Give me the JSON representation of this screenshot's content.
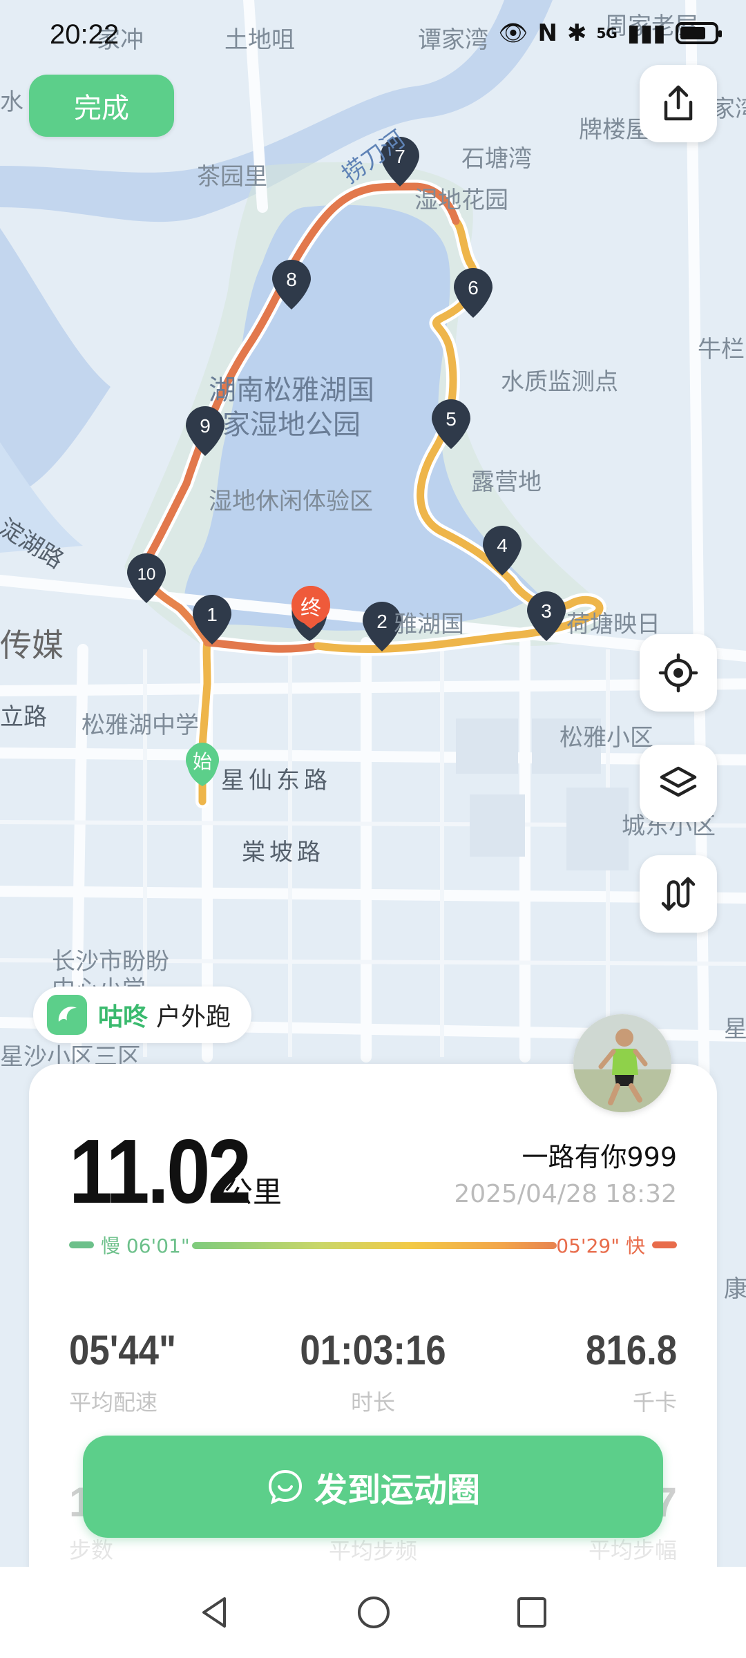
{
  "status_bar": {
    "time": "20:22",
    "signal": "5G"
  },
  "header": {
    "done_label": "完成"
  },
  "map": {
    "labels": [
      "家冲",
      "土地咀",
      "谭家湾",
      "周家老屋",
      "捞刀河",
      "石塘湾",
      "牌楼屋",
      "家湾",
      "茶园里",
      "湿地花园",
      "牛栏",
      "水质监测点",
      "湖南松雅湖国",
      "家湿地公园",
      "露营地",
      "湿地休闲体验区",
      "淀湖路",
      "传媒",
      "雅湖国",
      "荷塘映日",
      "立路",
      "松雅湖中学",
      "星仙东路",
      "松雅小区",
      "棠坡路",
      "城东小区",
      "长沙市盼盼",
      "中心小学",
      "星沙小区三区",
      "星",
      "康",
      "水"
    ],
    "km_markers": [
      "1",
      "2",
      "3",
      "4",
      "5",
      "6",
      "7",
      "8",
      "9",
      "10"
    ],
    "start_label": "始",
    "end_label": "终"
  },
  "app_badge": {
    "brand": "咕咚",
    "type": "户外跑"
  },
  "summary": {
    "distance": "11.02",
    "distance_unit": "公里",
    "username": "一路有你999",
    "datetime": "2025/04/28 18:32",
    "pace_slow": "慢 06'01\"",
    "pace_fast": "05'29\" 快"
  },
  "stats": [
    {
      "value": "05'44\"",
      "label": "平均配速"
    },
    {
      "value": "01:03:16",
      "label": "时长"
    },
    {
      "value": "816.8",
      "label": "千卡"
    }
  ],
  "stats_row2": [
    {
      "value": "1",
      "label": "步数"
    },
    {
      "value": "",
      "label": "平均步频"
    },
    {
      "value": "7",
      "label": "平均步幅"
    }
  ],
  "share": {
    "label": "发到运动圈"
  },
  "colors": {
    "accent": "#5ccf8a",
    "route_fast": "#e2784c",
    "route_slow": "#eeb54a",
    "lake": "#bcd2ee"
  }
}
